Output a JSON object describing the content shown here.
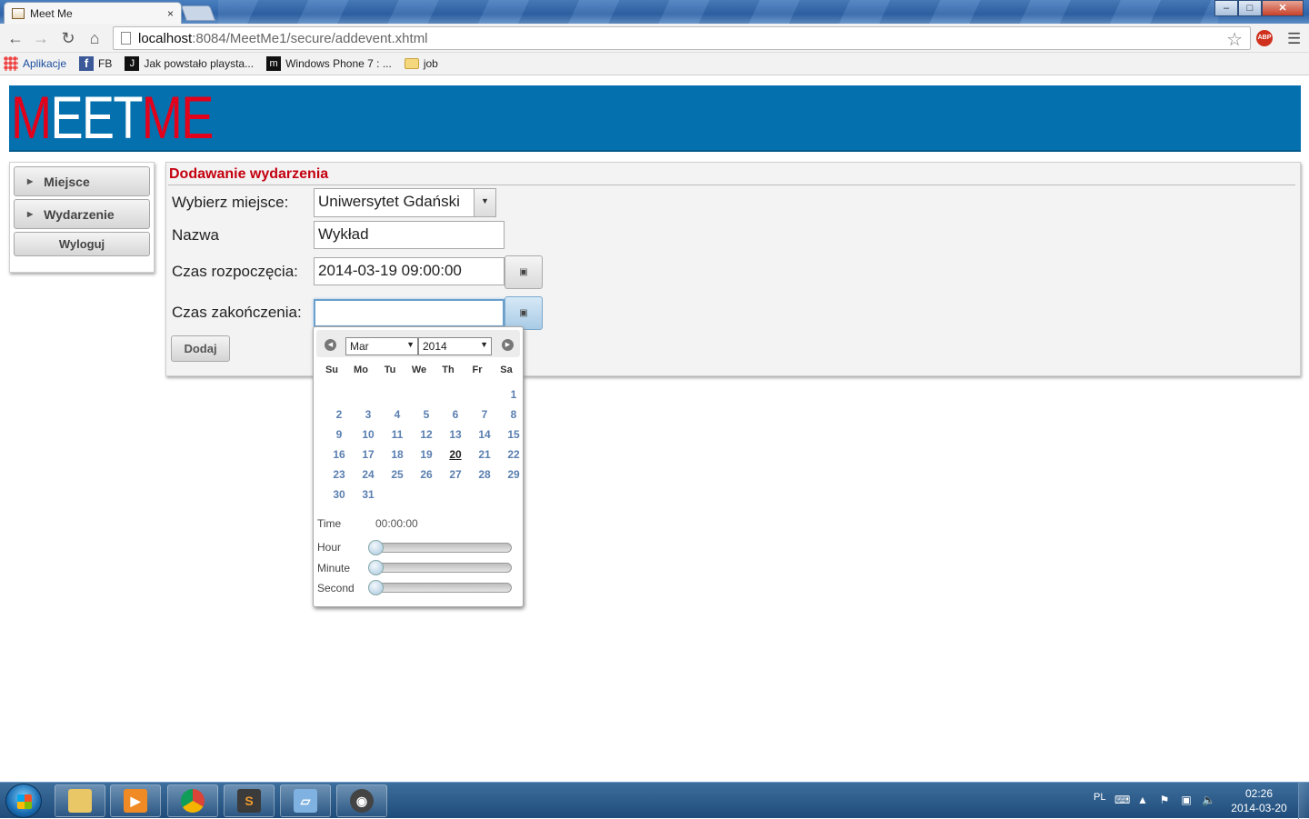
{
  "browser": {
    "tab_title": "Meet Me",
    "tab_close": "×",
    "url_host": "localhost",
    "url_path": ":8084/MeetMe1/secure/addevent.xhtml",
    "window_buttons": {
      "minimize": "–",
      "maximize": "□",
      "close": "✕"
    },
    "abp_label": "ABP",
    "bookmarks": [
      {
        "label": "Aplikacje",
        "icon": "apps-icon"
      },
      {
        "label": "FB",
        "icon": "facebook-icon"
      },
      {
        "label": "Jak powstało playsta...",
        "icon": "bookmark-icon"
      },
      {
        "label": "Windows Phone 7 : ...",
        "icon": "bookmark-icon"
      },
      {
        "label": "job",
        "icon": "folder-icon"
      }
    ]
  },
  "app": {
    "logo_part1": "M",
    "logo_part2": "EET",
    "logo_part3": "ME",
    "colors": {
      "banner": "#0570ae",
      "logo_red": "#e3001b",
      "title_red": "#c4000f"
    }
  },
  "sidebar": {
    "items": [
      {
        "label": "Miejsce"
      },
      {
        "label": "Wydarzenie"
      }
    ],
    "logout_label": "Wyloguj"
  },
  "form": {
    "title": "Dodawanie wydarzenia",
    "place_label": "Wybierz miejsce:",
    "place_value": "Uniwersytet Gdański",
    "name_label": "Nazwa",
    "name_value": "Wykład",
    "start_label": "Czas rozpoczęcia:",
    "start_value": "2014-03-19 09:00:00",
    "end_label": "Czas zakończenia:",
    "end_value": "",
    "submit_label": "Dodaj"
  },
  "datepicker": {
    "month": "Mar",
    "year": "2014",
    "weekdays": [
      "Su",
      "Mo",
      "Tu",
      "We",
      "Th",
      "Fr",
      "Sa"
    ],
    "days": [
      "1",
      "2",
      "3",
      "4",
      "5",
      "6",
      "7",
      "8",
      "9",
      "10",
      "11",
      "12",
      "13",
      "14",
      "15",
      "16",
      "17",
      "18",
      "19",
      "20",
      "21",
      "22",
      "23",
      "24",
      "25",
      "26",
      "27",
      "28",
      "29",
      "30",
      "31"
    ],
    "first_weekday_index": 6,
    "today": "20",
    "time_label": "Time",
    "time_value": "00:00:00",
    "hour_label": "Hour",
    "minute_label": "Minute",
    "second_label": "Second",
    "hour": 0,
    "minute": 0,
    "second": 0
  },
  "taskbar": {
    "language": "PL",
    "time": "02:26",
    "date": "2014-03-20"
  }
}
